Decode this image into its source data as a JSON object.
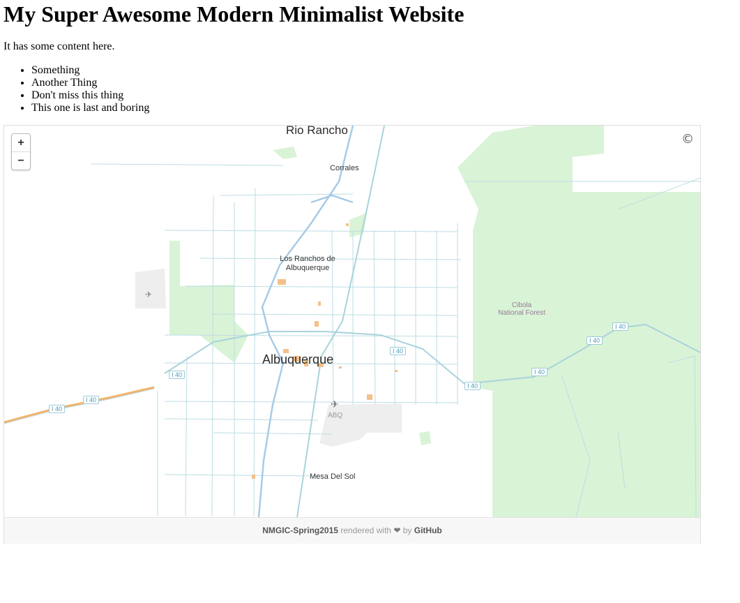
{
  "page": {
    "heading": "My Super Awesome Modern Minimalist Website",
    "intro": "It has some content here.",
    "list": [
      "Something",
      "Another Thing",
      "Don't miss this thing",
      "This one is last and boring"
    ]
  },
  "map": {
    "zoom_in": "+",
    "zoom_out": "−",
    "attribution": "©",
    "labels": {
      "rio_rancho": "Rio Rancho",
      "corrales": "Corrales",
      "los_ranchos_1": "Los Ranchos de",
      "los_ranchos_2": "Albuquerque",
      "albuquerque": "Albuquerque",
      "cibola_1": "Cibola",
      "cibola_2": "National Forest",
      "airport": "ABQ",
      "mesa_del_sol": "Mesa Del Sol"
    },
    "interstate": "I 40",
    "colors": {
      "park": "#d7f2d4",
      "road": "#a9d3dc",
      "river": "#a8cbe6",
      "highway": "#f0b36a",
      "airport": "#f0f0f0"
    }
  },
  "footer": {
    "repo": "NMGIC-Spring2015",
    "rendered_with": "rendered with",
    "heart": "❤",
    "by": "by",
    "host": "GitHub"
  }
}
